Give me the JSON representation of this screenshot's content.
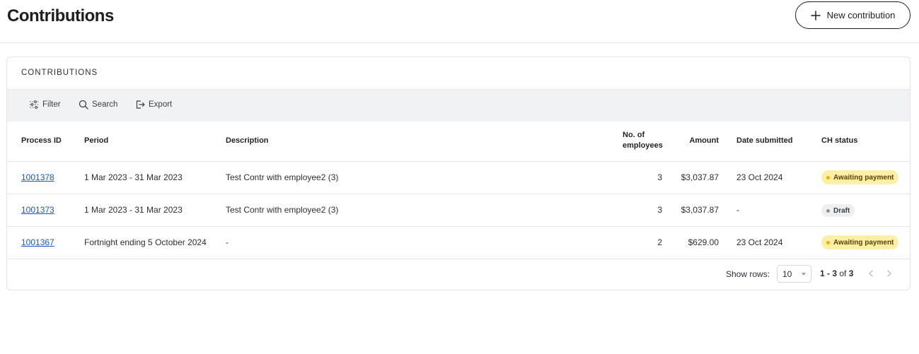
{
  "page": {
    "title": "Contributions",
    "new_button_label": "New contribution"
  },
  "card": {
    "title": "CONTRIBUTIONS"
  },
  "toolbar": {
    "filter": "Filter",
    "search": "Search",
    "export": "Export"
  },
  "table": {
    "headers": {
      "process_id": "Process ID",
      "period": "Period",
      "description": "Description",
      "employees_1": "No. of",
      "employees_2": "employees",
      "amount": "Amount",
      "date_submitted": "Date submitted",
      "status": "CH status"
    },
    "rows": [
      {
        "process_id": "1001378",
        "period": "1 Mar 2023 - 31 Mar 2023",
        "description": "Test Contr with employee2 (3)",
        "employees": "3",
        "amount": "$3,037.87",
        "date_submitted": "23 Oct 2024",
        "status": "Awaiting payment"
      },
      {
        "process_id": "1001373",
        "period": "1 Mar 2023 - 31 Mar 2023",
        "description": "Test Contr with employee2 (3)",
        "employees": "3",
        "amount": "$3,037.87",
        "date_submitted": "-",
        "status": "Draft"
      },
      {
        "process_id": "1001367",
        "period": "Fortnight ending 5 October 2024",
        "description": "-",
        "employees": "2",
        "amount": "$629.00",
        "date_submitted": "23 Oct 2024",
        "status": "Awaiting payment"
      }
    ]
  },
  "pagination": {
    "show_rows_label": "Show rows:",
    "rows_value": "10",
    "range": "1 - 3",
    "of": "of",
    "total": "3"
  },
  "colors": {
    "link": "#1a56c4",
    "awaiting_bg": "#fdf0a6",
    "awaiting_dot": "#e9b200",
    "draft_bg": "#eeeff1",
    "toolbar_bg": "#f1f2f4"
  },
  "icons": {
    "new": "plus-icon",
    "filter": "sliders-icon",
    "search": "search-icon",
    "export": "export-icon",
    "prev": "chevron-left-icon",
    "next": "chevron-right-icon"
  }
}
